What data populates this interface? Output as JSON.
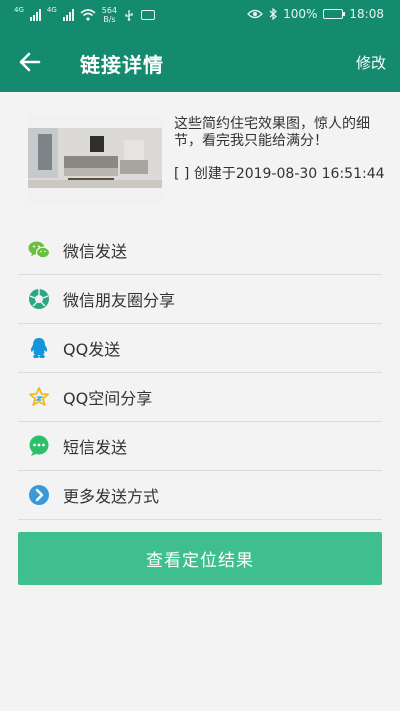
{
  "statusbar": {
    "sim1": "4G",
    "sim2": "4G",
    "speed_value": "564",
    "speed_unit": "B/s",
    "battery": "100%",
    "time": "18:08"
  },
  "appbar": {
    "title": "链接详情",
    "edit_label": "修改"
  },
  "article": {
    "description": "这些简约住宅效果图，惊人的细节，看完我只能给满分！",
    "created_prefix": "[ ]",
    "created_label": "创建于2019-08-30 16:51:44"
  },
  "share_options": [
    {
      "label": "微信发送",
      "icon": "wechat-icon",
      "color": "#6abf40"
    },
    {
      "label": "微信朋友圈分享",
      "icon": "moments-icon",
      "color": "#2aa882"
    },
    {
      "label": "QQ发送",
      "icon": "qq-icon",
      "color": "#1296db"
    },
    {
      "label": "QQ空间分享",
      "icon": "qzone-icon",
      "color": "#f3b81c"
    },
    {
      "label": "短信发送",
      "icon": "sms-icon",
      "color": "#2dbf6a"
    },
    {
      "label": "更多发送方式",
      "icon": "more-icon",
      "color": "#3a9ad9"
    }
  ],
  "action": {
    "label": "查看定位结果"
  },
  "colors": {
    "header": "#148a6e",
    "button": "#3fbf8f",
    "background": "#f3f3f3"
  }
}
